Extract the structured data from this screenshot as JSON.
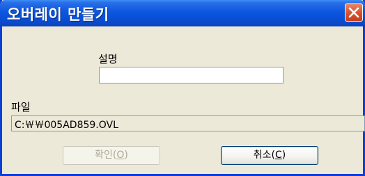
{
  "window": {
    "title": "오버레이 만들기",
    "title_bar_color": "#0a4fd6",
    "background_color": "#ece9d8"
  },
  "icons": {
    "close": "close-icon"
  },
  "description": {
    "label": "설명",
    "value": ""
  },
  "file": {
    "label": "파일",
    "value": "C:￦￦005AD859.OVL"
  },
  "buttons": {
    "ok": {
      "text": "확인(",
      "mnemonic": "O",
      "suffix": ")",
      "enabled": false
    },
    "cancel": {
      "text": "취소(",
      "mnemonic": "C",
      "suffix": ")",
      "enabled": true
    }
  }
}
